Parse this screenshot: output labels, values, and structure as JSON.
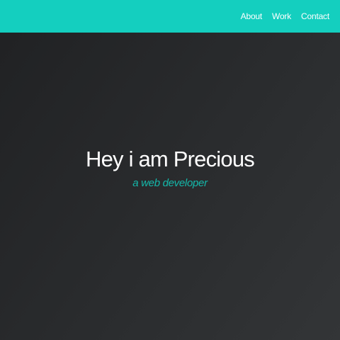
{
  "nav": {
    "items": [
      {
        "label": "About"
      },
      {
        "label": "Work"
      },
      {
        "label": "Contact"
      }
    ]
  },
  "hero": {
    "title": "Hey i am Precious",
    "subtitle": "a web developer"
  },
  "colors": {
    "accent": "#14cfbf",
    "background": "#2a2c2e",
    "subtitle": "#14b8aa"
  }
}
